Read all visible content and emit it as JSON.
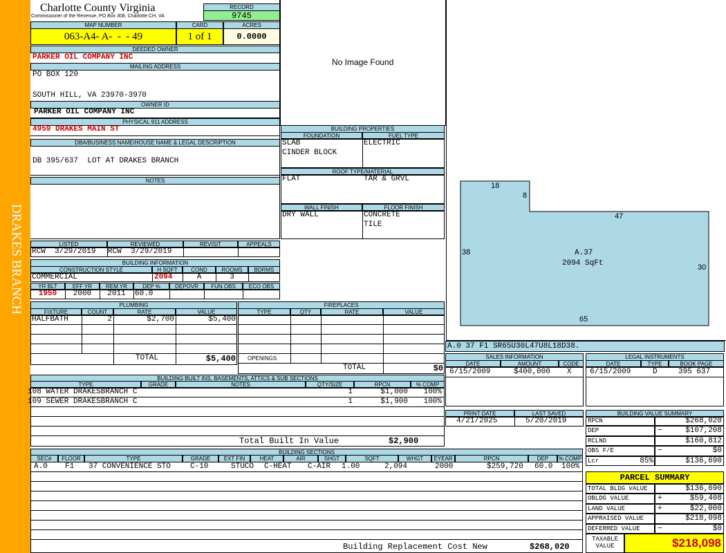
{
  "sidebar": {
    "label": "DRAKES BRANCH"
  },
  "header": {
    "county": "Charlotte County Virginia",
    "commissioner": "Commissioner of the Revenue, PO Box 308, Charlotte CH, VA",
    "record_label": "RECORD",
    "record": "9745",
    "map_number_label": "MAP NUMBER",
    "map_number": "063-A4- A-  -  - 49",
    "card_label": "CARD",
    "card": "1 of 1",
    "acres_label": "ACRES",
    "acres": "0.0000"
  },
  "owner": {
    "deeded_owner_label": "DEEDED OWNER",
    "deeded_owner": "PARKER OIL COMPANY INC",
    "mailing_address_label": "MAILING ADDRESS",
    "mailing_line1": "PO BOX 120",
    "mailing_line2": "",
    "mailing_line3": "SOUTH HILL, VA 23970-3970",
    "owner_id_label": "OWNER ID",
    "owner_id": "PARKER OIL COMPANY INC",
    "physical_label": "PHYSICAL 911 ADDRESS",
    "physical": "4959 DRAKES MAIN ST",
    "dba_label": "DBA/BUSINESS NAME/HOUSE NAME & LEGAL DESCRIPTION",
    "dba": "DB 395/637  LOT AT DRAKES BRANCH",
    "notes_label": "NOTES"
  },
  "photo": {
    "text": "No Image Found"
  },
  "listed": {
    "listed_label": "LISTED",
    "listed": "RCW  3/29/2019",
    "reviewed_label": "REVIEWED",
    "reviewed": "RCW  3/29/2019",
    "revisit_label": "REVISIT",
    "appeals_label": "APPEALS"
  },
  "building_info": {
    "title": "BUILDING INFORMATION",
    "construction_label": "CONSTRUCTION STYLE",
    "construction": "COMMERCIAL",
    "hsqft_label": "H SQFT",
    "hsqft": "2094",
    "cond_label": "COND",
    "cond": "A",
    "rooms_label": "ROOMS",
    "rooms": "3",
    "bdrms_label": "BDRMS",
    "bdrms": "",
    "yrblt_label": "YR BLT",
    "yrblt": "1950",
    "effyr_label": "EFF YR",
    "effyr": "2000",
    "remyr_label": "REM YR",
    "remyr": "2011",
    "dep_label": "DEP %",
    "dep": "60.0",
    "depovr_label": "DEPOVR",
    "funobs_label": "FUN OBS",
    "ecoobs_label": "ECO OBS"
  },
  "building_props": {
    "title": "BUILDING PROPERTIES",
    "foundation_label": "FOUNDATION",
    "foundation1": "SLAB",
    "foundation2": "CINDER BLOCK",
    "fuel_label": "FUEL TYPE",
    "fuel": "ELECTRIC",
    "roof_label": "ROOF TYPE/MATERIAL",
    "roof_type": "FLAT",
    "roof_material": "TAR & GRVL",
    "wall_label": "WALL FINISH",
    "wall": "DRY WALL",
    "floor_label": "FLOOR FINISH",
    "floor1": "CONCRETE",
    "floor2": "TILE"
  },
  "sketch": {
    "dim_top": "18",
    "dim_notch": "8",
    "dim_upper_right": "47",
    "dim_left": "38",
    "dim_right": "30",
    "dim_bottom": "65",
    "label": "A.37",
    "area": "2094 SqFt",
    "code": "A.0  37  F1  SR65U30L47U8L18D38."
  },
  "plumbing": {
    "title": "PLUMBING",
    "headers": [
      "FIXTURE",
      "COUNT",
      "RATE",
      "VALUE"
    ],
    "rows": [
      [
        "HALFBATH",
        "2",
        "$2,700",
        "$5,400"
      ]
    ],
    "total_label": "TOTAL",
    "total": "$5,400"
  },
  "fireplaces": {
    "title": "FIREPLACES",
    "headers": [
      "TYPE",
      "QTY",
      "RATE",
      "VALUE"
    ],
    "openings_label": "OPENINGS",
    "total_label": "TOTAL",
    "total": "$0"
  },
  "builtins": {
    "title": "BUILDING BUILT INS, BASEMENTS, ATTICS & SUB SECTIONS",
    "headers": [
      "TYPE",
      "GRADE",
      "NOTES",
      "QTY/SIZE",
      "RPCN",
      "% COMP"
    ],
    "rows": [
      [
        "108 WATER DRAKESBRANCH C",
        "",
        "",
        "1",
        "$1,000",
        "100%"
      ],
      [
        "109 SEWER DRAKESBRANCH C",
        "",
        "",
        "1",
        "$1,900",
        "100%"
      ]
    ],
    "total_label": "Total Built In Value",
    "total": "$2,900"
  },
  "sections": {
    "title": "BUILDING SECTIONS",
    "headers": [
      "SEC#",
      "FLOOR",
      "TYPE",
      "GRADE",
      "EXT FIN",
      "HEAT",
      "AIR",
      "SHGT",
      "SQFT",
      "WHGT",
      "EYEAR",
      "RPCN",
      "DEP",
      "% COMP"
    ],
    "rows": [
      [
        "A.0",
        "F1",
        "37 CONVENIENCE STO",
        "C-10",
        "STUCO",
        "C-HEAT",
        "C-AIR",
        "1.00",
        "2,094",
        "",
        "2000",
        "$259,720",
        "60.0",
        "100%"
      ]
    ],
    "replacement_label": "Building Replacement Cost New",
    "replacement": "$268,020"
  },
  "sales": {
    "title": "SALES INFORMATION",
    "headers": [
      "DATE",
      "AMOUNT",
      "CODE"
    ],
    "rows": [
      [
        "6/15/2009",
        "$400,000",
        "X"
      ]
    ]
  },
  "legal": {
    "title": "LEGAL INSTRUMENTS",
    "headers": [
      "DATE",
      "TYPE",
      "BOOK PAGE"
    ],
    "rows": [
      [
        "6/15/2009",
        "D",
        "395 637"
      ]
    ]
  },
  "print": {
    "print_label": "PRINT DATE",
    "print_date": "4/21/2025",
    "saved_label": "LAST SAVED",
    "saved_date": "5/20/2019"
  },
  "value_summary": {
    "title": "BUILDING VALUE SUMMARY",
    "rows": [
      {
        "label": "RPCN",
        "mid": "",
        "sign": "",
        "value": "$268,020"
      },
      {
        "label": "DEP",
        "mid": "",
        "sign": "−",
        "value": "$107,208"
      },
      {
        "label": "RCLND",
        "mid": "",
        "sign": "",
        "value": "$160,812"
      },
      {
        "label": "OBS F/E",
        "mid": "",
        "sign": "−",
        "value": "$0"
      },
      {
        "label": "Lcr",
        "mid": "85%",
        "sign": "",
        "value": "$136,690"
      }
    ]
  },
  "parcel": {
    "title": "PARCEL SUMMARY",
    "rows": [
      {
        "label": "TOTAL BLDG VALUE",
        "sign": "",
        "value": "$136,690"
      },
      {
        "label": "OBLDG VALUE",
        "sign": "+",
        "value": "$59,408"
      },
      {
        "label": "LAND VALUE",
        "sign": "+",
        "value": "$22,000"
      },
      {
        "label": "APPRAISED VALUE",
        "sign": "",
        "value": "$218,098"
      },
      {
        "label": "DEFERRED VALUE",
        "sign": "−",
        "value": "$0"
      }
    ],
    "taxable_label1": "TAXABLE",
    "taxable_label2": "VALUE",
    "taxable": "$218,098"
  },
  "colors": {
    "sidebar": "#ffa500",
    "header": "#add8e6",
    "highlight": "#ffff00",
    "record": "#90ee90",
    "sketch": "#add8e6"
  }
}
